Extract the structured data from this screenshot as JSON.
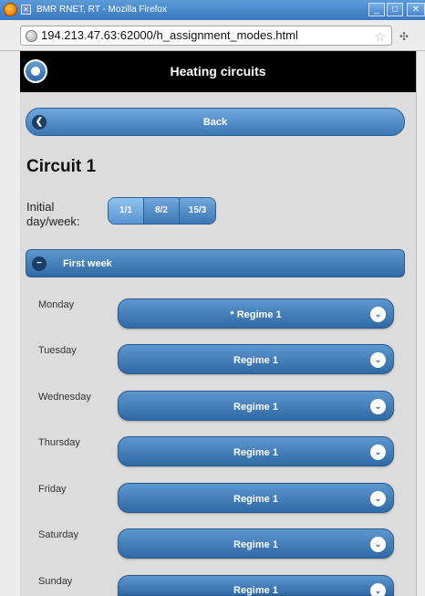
{
  "window": {
    "title": "BMR RNET, RT - Mozilla Firefox",
    "badge": "✕",
    "buttons": {
      "minimize": "_",
      "maximize": "□",
      "close": "✕"
    }
  },
  "browser": {
    "url": "194.213.47.63:62000/h_assignment_modes.html",
    "icons": {
      "site": "globe-icon",
      "bookmark": "star-icon",
      "extension": "puzzle-icon"
    },
    "star_glyph": "☆",
    "ext_glyph": "✣"
  },
  "header": {
    "title": "Heating circuits",
    "home_icon": "home-icon"
  },
  "back": {
    "label": "Back",
    "icon_glyph": "❮"
  },
  "circuit": {
    "title": "Circuit 1"
  },
  "initial": {
    "label": "Initial day/week:",
    "options": [
      {
        "label": "1/1",
        "active": true
      },
      {
        "label": "8/2",
        "active": false
      },
      {
        "label": "15/3",
        "active": false
      }
    ]
  },
  "section": {
    "label": "First week",
    "icon_glyph": "−",
    "collapsed": false
  },
  "days": [
    {
      "day": "Monday",
      "value": "* Regime 1"
    },
    {
      "day": "Tuesday",
      "value": "Regime 1"
    },
    {
      "day": "Wednesday",
      "value": "Regime 1"
    },
    {
      "day": "Thursday",
      "value": "Regime 1"
    },
    {
      "day": "Friday",
      "value": "Regime 1"
    },
    {
      "day": "Saturday",
      "value": "Regime 1"
    },
    {
      "day": "Sunday",
      "value": "Regime 1"
    }
  ],
  "chevron_glyph": "⌄",
  "colors": {
    "accent": "#3d77b3",
    "header_bg": "#000000",
    "page_bg": "#dcdcdc"
  }
}
